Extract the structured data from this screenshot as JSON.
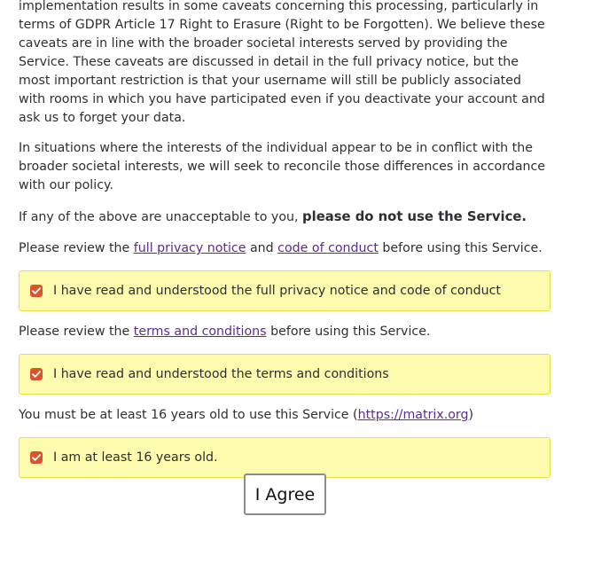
{
  "intro": {
    "paragraph1": "implementation results in some caveats concerning this processing, particularly in terms of GDPR Article 17 Right to Erasure (Right to be Forgotten). We believe these caveats are in line with the broader societal interests served by providing the Service. These caveats are discussed in detail in the full privacy notice, but the most important restriction is that your username will still be publicly associated with rooms in which you have participated even if you deactivate your account and ask us to forget your data.",
    "paragraph2": "In situations where the interests of the individual appear to be in conflict with the broader societal interests, we will seek to reconcile those differences in accordance with our policy.",
    "paragraph3_prefix": "If any of the above are unacceptable to you, ",
    "paragraph3_bold": "please do not use the Service."
  },
  "privacy_review": {
    "prefix": "Please review the ",
    "privacy_link": "full privacy notice",
    "middle": " and ",
    "conduct_link": "code of conduct",
    "suffix": " before using this Service."
  },
  "privacy_consent": {
    "checked": true,
    "label": "I have read and understood the full privacy notice and code of conduct"
  },
  "terms_review": {
    "prefix": "Please review the ",
    "terms_link": "terms and conditions",
    "suffix": " before using this Service."
  },
  "terms_consent": {
    "checked": true,
    "label": "I have read and understood the terms and conditions"
  },
  "age_notice": {
    "prefix": "You must be at least 16 years old to use this Service (",
    "link": "https://matrix.org",
    "suffix": ")"
  },
  "age_consent": {
    "checked": true,
    "label": "I am at least 16 years old."
  },
  "agree_button": {
    "label": "I Agree"
  },
  "colors": {
    "consent_background": "#fdfbad",
    "consent_border": "#e8de4a",
    "checkbox_fill": "#d9542b",
    "link": "#5c2c8c"
  },
  "icons": {
    "checkbox": "checkmark-icon"
  }
}
